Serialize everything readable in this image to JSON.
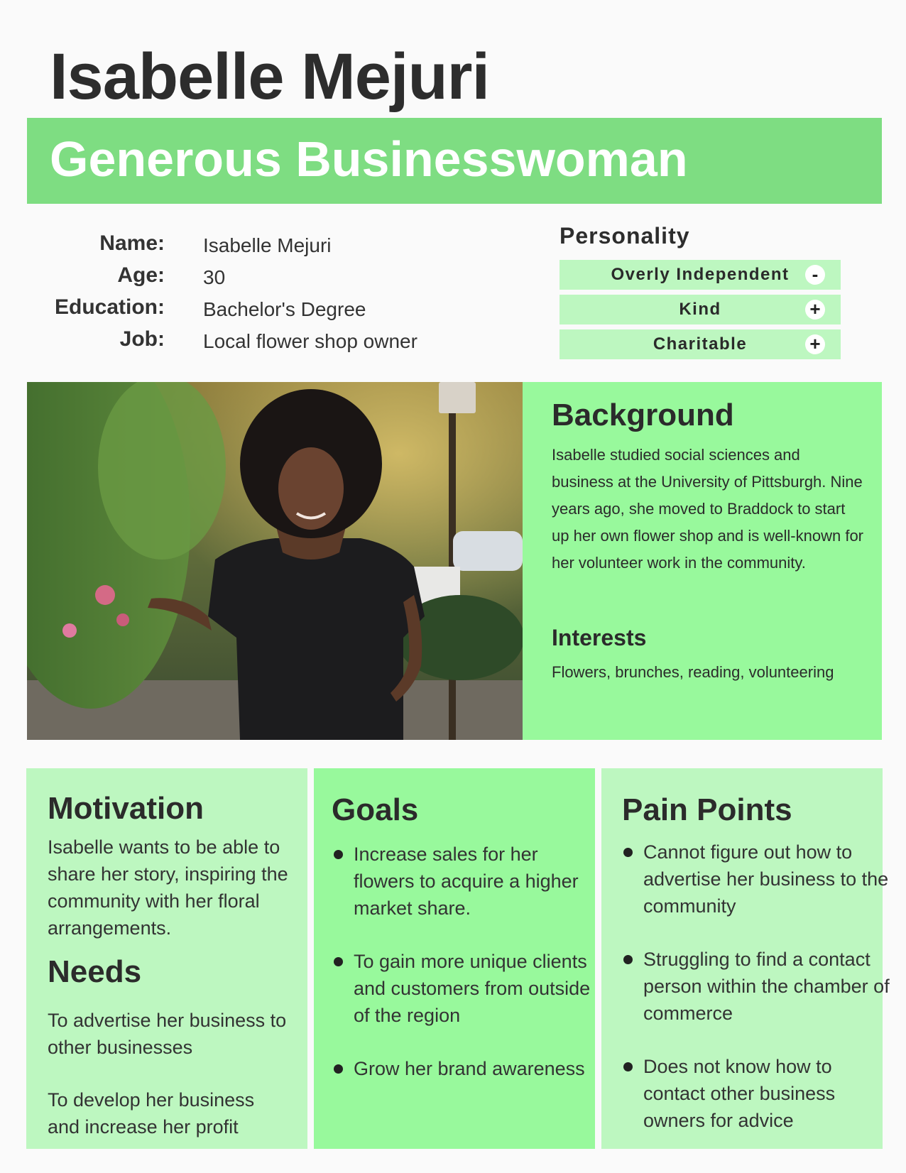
{
  "persona": {
    "name": "Isabelle Mejuri",
    "tagline": "Generous Businesswoman"
  },
  "info": {
    "rows": [
      {
        "label": "Name:",
        "value": "Isabelle Mejuri"
      },
      {
        "label": "Age:",
        "value": "30"
      },
      {
        "label": "Education:",
        "value": "Bachelor's Degree"
      },
      {
        "label": "Job:",
        "value": "Local flower shop owner"
      }
    ]
  },
  "personality": {
    "heading": "Personality",
    "traits": [
      {
        "label": "Overly Independent",
        "sign": "-"
      },
      {
        "label": "Kind",
        "sign": "+"
      },
      {
        "label": "Charitable",
        "sign": "+"
      }
    ]
  },
  "background": {
    "title": "Background",
    "text": "Isabelle studied social sciences and business at the University of Pittsburgh. Nine years ago, she moved to Braddock to start up her own flower shop and is well-known for her volunteer work in the community."
  },
  "interests": {
    "title": "Interests",
    "text": "Flowers, brunches, reading, volunteering"
  },
  "motivation": {
    "title": "Motivation",
    "text": "Isabelle wants to be able to share her story, inspiring the community with her floral arrangements."
  },
  "needs": {
    "title": "Needs",
    "items": [
      "To advertise her business to other businesses",
      "To develop her business and increase her profit"
    ]
  },
  "goals": {
    "title": "Goals",
    "items": [
      "Increase sales for her flowers to acquire a higher market share.",
      "To gain more unique clients and customers from outside of the region",
      "Grow her brand awareness"
    ]
  },
  "pain_points": {
    "title": "Pain Points",
    "items": [
      "Cannot figure out how to advertise her business to the community",
      "Struggling to find a contact person within the chamber of commerce",
      "Does not know how to contact other business owners for advice"
    ]
  }
}
